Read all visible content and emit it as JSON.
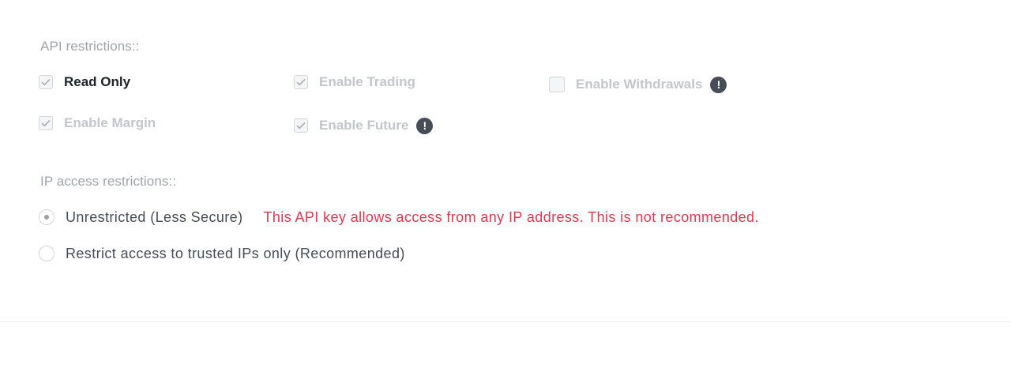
{
  "api_restrictions": {
    "label": "API restrictions::",
    "options": [
      {
        "label": "Read Only",
        "checked": true,
        "active": true,
        "warning_icon": false
      },
      {
        "label": "Enable Trading",
        "checked": true,
        "active": false,
        "warning_icon": false
      },
      {
        "label": "Enable Withdrawals",
        "checked": false,
        "active": false,
        "warning_icon": true
      },
      {
        "label": "Enable Margin",
        "checked": true,
        "active": false,
        "warning_icon": false
      },
      {
        "label": "Enable Future",
        "checked": true,
        "active": false,
        "warning_icon": true
      }
    ]
  },
  "ip_restrictions": {
    "label": "IP access restrictions::",
    "options": [
      {
        "label": "Unrestricted (Less Secure)",
        "selected": true,
        "warning": "This API key allows access from any IP address. This is not recommended."
      },
      {
        "label": "Restrict access to trusted IPs only (Recommended)",
        "selected": false
      }
    ]
  },
  "icons": {
    "warning": "!",
    "checkmark": "checkmark-icon",
    "warning_name": "exclamation-circle-icon"
  },
  "colors": {
    "active_text": "#1e2329",
    "disabled_text": "#c3c6cb",
    "warning_text": "#e0394e",
    "warning_icon_bg": "#474d57"
  }
}
